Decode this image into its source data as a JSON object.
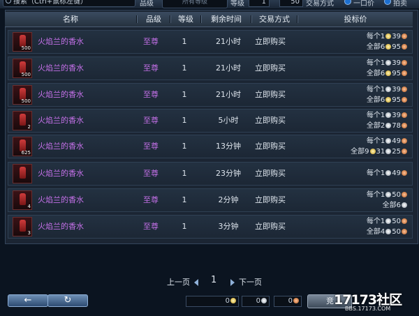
{
  "search": {
    "placeholder": "搜索（Ctrl+鼠标左键）"
  },
  "filters": {
    "grade_label": "品级",
    "grade_value": "所有等级",
    "level_label": "等级",
    "level_min": "1",
    "level_max": "50",
    "trade_label": "交易方式",
    "radio1_label": "一口价",
    "radio2_label": "拍卖"
  },
  "columns": [
    "名称",
    "品级",
    "等级",
    "剩余时间",
    "交易方式",
    "投标价"
  ],
  "rows": [
    {
      "name": "火焰兰的香水",
      "count": "500",
      "grade": "至尊",
      "level": "1",
      "time": "21小时",
      "trade": "立即购买",
      "unit_label": "每个1",
      "unit_silver": "39",
      "all_label": "全部6",
      "all_silver": "95"
    },
    {
      "name": "火焰兰的香水",
      "count": "500",
      "grade": "至尊",
      "level": "1",
      "time": "21小时",
      "trade": "立即购买",
      "unit_label": "每个1",
      "unit_silver": "39",
      "all_label": "全部6",
      "all_silver": "95"
    },
    {
      "name": "火焰兰的香水",
      "count": "500",
      "grade": "至尊",
      "level": "1",
      "time": "21小时",
      "trade": "立即购买",
      "unit_label": "每个1",
      "unit_silver": "39",
      "all_label": "全部6",
      "all_silver": "95"
    },
    {
      "name": "火焰兰的香水",
      "count": "2",
      "grade": "至尊",
      "level": "1",
      "time": "5小时",
      "trade": "立即购买",
      "unit_label": "每个1",
      "unit_silver": "39",
      "all_label": "全部2",
      "all_silver": "78"
    },
    {
      "name": "火焰兰的香水",
      "count": "625",
      "grade": "至尊",
      "level": "1",
      "time": "13分钟",
      "trade": "立即购买",
      "unit_label": "每个1",
      "unit_silver": "49",
      "all_label": "全部9",
      "all_silver": "31",
      "all_copper": "25"
    },
    {
      "name": "火焰兰的香水",
      "count": "",
      "grade": "至尊",
      "level": "1",
      "time": "23分钟",
      "trade": "立即购买",
      "unit_label": "每个1",
      "unit_silver": "49",
      "all_label": "",
      "all_silver": ""
    },
    {
      "name": "火焰兰的香水",
      "count": "4",
      "grade": "至尊",
      "level": "1",
      "time": "2分钟",
      "trade": "立即购买",
      "unit_label": "每个1",
      "unit_silver": "50",
      "all_label": "全部6",
      "all_silver": ""
    },
    {
      "name": "火焰兰的香水",
      "count": "3",
      "grade": "至尊",
      "level": "1",
      "time": "3分钟",
      "trade": "立即购买",
      "unit_label": "每个1",
      "unit_silver": "50",
      "all_label": "全部4",
      "all_silver": "50"
    }
  ],
  "pager": {
    "prev": "上一页",
    "page": "1",
    "next": "下一页"
  },
  "bottom": {
    "money1": "0",
    "money2": "0",
    "money3": "0",
    "buy_label": "竞"
  },
  "watermark": {
    "logo": "17173社区",
    "url": "BBS.17173.COM"
  }
}
